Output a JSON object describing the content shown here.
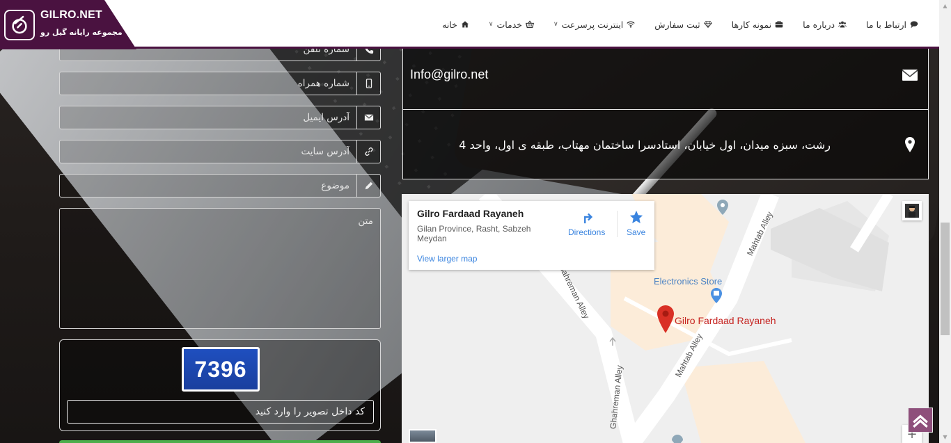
{
  "brand": {
    "title": "GILRO.NET",
    "subtitle": "مجموعه رایانه گیل رو",
    "accent": "#4a1240"
  },
  "nav": {
    "items": [
      {
        "label": "خانه",
        "icon": "home-icon"
      },
      {
        "label": "خدمات",
        "icon": "basket-icon",
        "dropdown": true
      },
      {
        "label": "اینترنت پرسرعت",
        "icon": "wifi-icon",
        "dropdown": true
      },
      {
        "label": "ثبت سفارش",
        "icon": "diamond-icon"
      },
      {
        "label": "نمونه کارها",
        "icon": "briefcase-icon"
      },
      {
        "label": "درباره ما",
        "icon": "users-icon"
      },
      {
        "label": "ارتباط با ما",
        "icon": "comment-icon"
      }
    ]
  },
  "form": {
    "phone_placeholder": "شماره تلفن",
    "mobile_placeholder": "شماره همراه",
    "email_placeholder": "آدرس ایمیل",
    "website_placeholder": "آدرس سایت",
    "subject_placeholder": "موضوع",
    "message_placeholder": "متن",
    "captcha_code": "7396",
    "captcha_placeholder": "کد داخل تصویر را وارد کنید"
  },
  "contact": {
    "email": "Info@gilro.net",
    "address": "رشت، سبزه میدان، اول خیابان، استادسرا ساختمان مهتاب، طبقه ی اول، واحد 4"
  },
  "map": {
    "place_name": "Gilro Fardaad Rayaneh",
    "place_address": "Gilan Province, Rasht, Sabzeh Meydan",
    "directions_label": "Directions",
    "save_label": "Save",
    "larger_map_label": "View larger map",
    "labels": {
      "electronics_store": "Electronics Store",
      "marker_label": "Gilro Fardaad Rayaneh",
      "mahtab_alley_top": "Mahtab Alley",
      "mahtab_alley_bottom": "Mahtab Alley",
      "ghahreman_alley_top": "Ghahreman Alley",
      "ghahreman_alley_bottom": "Ghahreman Alley"
    }
  }
}
